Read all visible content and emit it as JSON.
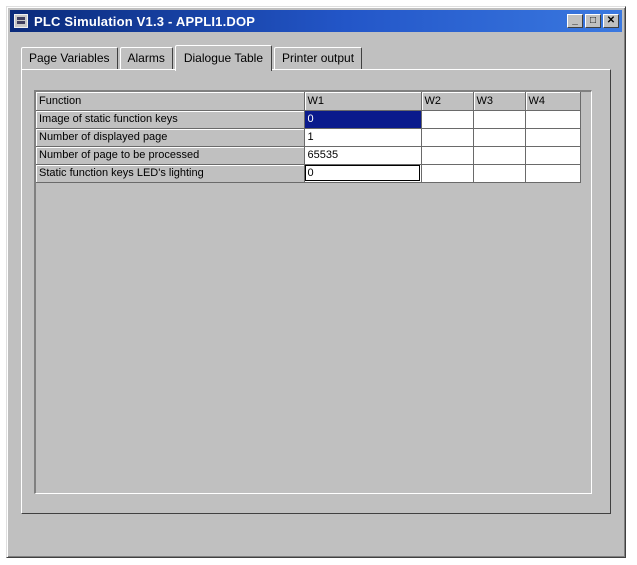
{
  "window": {
    "title": "PLC Simulation V1.3 - APPLI1.DOP",
    "controls": {
      "minimize": "_",
      "maximize": "□",
      "close": "✕"
    }
  },
  "tabs": [
    {
      "label": "Page Variables",
      "active": false
    },
    {
      "label": "Alarms",
      "active": false
    },
    {
      "label": "Dialogue Table",
      "active": true
    },
    {
      "label": "Printer output",
      "active": false
    }
  ],
  "table": {
    "headers": [
      "Function",
      "W1",
      "W2",
      "W3",
      "W4"
    ],
    "rows": [
      {
        "function": "Image of static function keys",
        "values": [
          "0",
          "",
          "",
          ""
        ]
      },
      {
        "function": "Number of displayed page",
        "values": [
          "1",
          "",
          "",
          ""
        ]
      },
      {
        "function": "Number of page to be processed",
        "values": [
          "65535",
          "",
          "",
          ""
        ]
      },
      {
        "function": "Static function keys LED's lighting",
        "values": [
          "0",
          "",
          "",
          ""
        ]
      }
    ]
  },
  "colors": {
    "titlebar": "#0a2a7a",
    "selection": "#0a1a8c",
    "face": "#c0c0c0"
  }
}
